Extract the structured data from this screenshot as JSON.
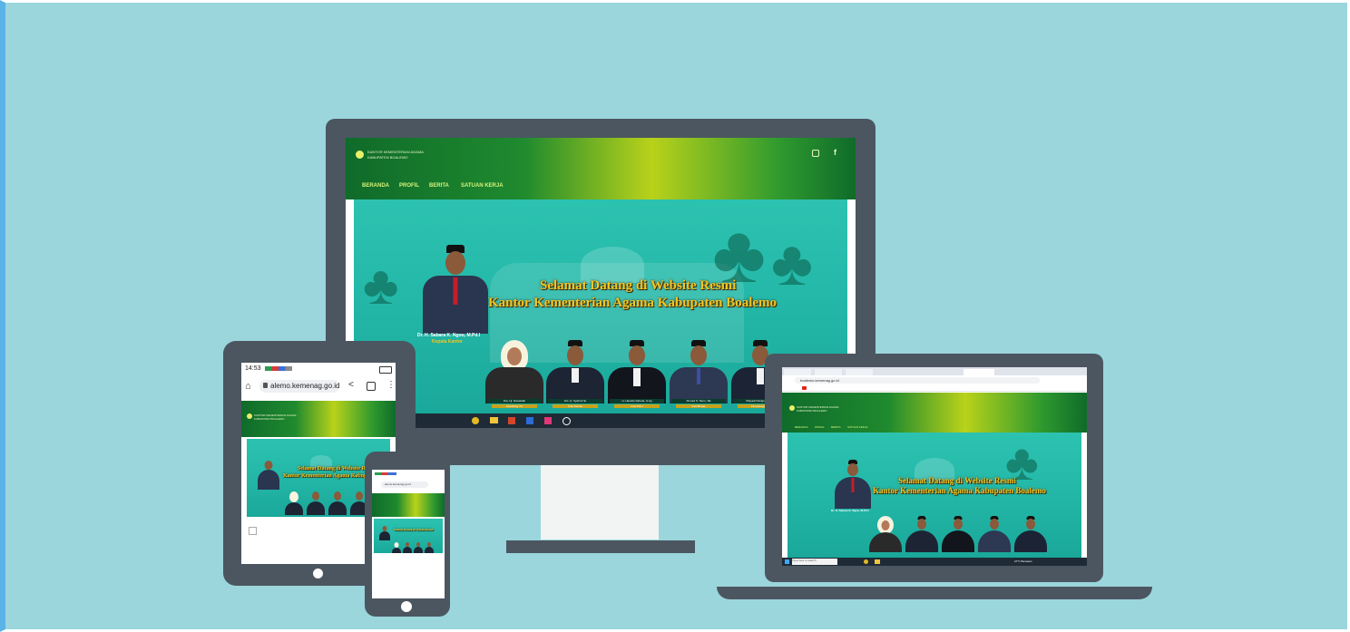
{
  "site": {
    "org_name_line1": "KANTOR KEMENTERIAN AGAMA",
    "org_name_line2": "KABUPATEN BOALEMO",
    "nav": [
      "BERANDA",
      "PROFIL",
      "BERITA",
      "SATUAN KERJA"
    ],
    "hero_title_line1": "Selamat Datang di Website Resmi",
    "hero_title_line2": "Kantor Kementerian Agama Kabupaten Boalemo",
    "head_name": "Dr. H. Sabara K. Ngou, M.Pd.I",
    "head_role": "Kepala Kantor",
    "staff": [
      {
        "name": "Dra. Hj. Ruwaidah",
        "role": "Kasubbag TU"
      },
      {
        "name": "Drs. H. Syahrul Ilo",
        "role": "Kasi Pendis"
      },
      {
        "name": "H. Hamdie Ilahude, S.Ag",
        "role": "Kasi PHU"
      },
      {
        "name": "Ahmad S. Tamu, SE",
        "role": "Kasi Bimas"
      },
      {
        "name": "Mulyadi Panigoro, S.Pd",
        "role": "Penyelenggara"
      }
    ]
  },
  "tablet": {
    "status_time": "14:53",
    "url": "alemo.kemenag.go.id"
  },
  "laptop": {
    "url": "boalemo.kemenag.go.id",
    "search_placeholder": "Type here to search",
    "weather": "27°C Berawan"
  },
  "colors": {
    "background": "#9ad6dc",
    "bezel": "#4b5661",
    "header_green": "#1f8a2e",
    "hero_teal": "#24b8a8",
    "title_gold": "#f3c623"
  }
}
